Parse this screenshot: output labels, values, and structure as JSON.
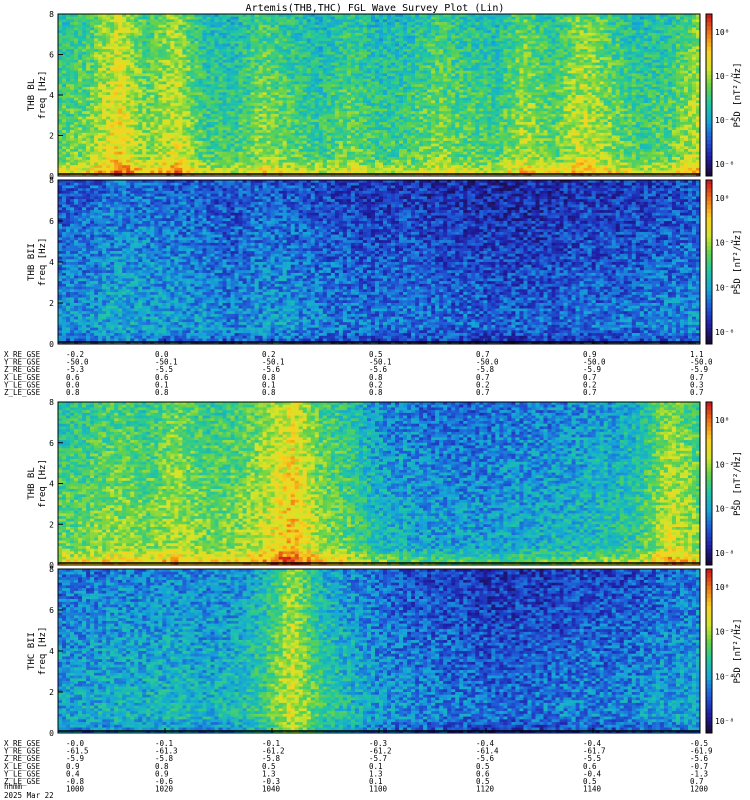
{
  "title": "Artemis(THB,THC) FGL Wave Survey Plot (Lin)",
  "date_label": "2025 Mar 22",
  "time_axis_label": "hhmm",
  "colorbar_label": "PSD [nT²/Hz]",
  "colors": {
    "colormap": [
      "#1b0a3b",
      "#1f1fa8",
      "#1f5ad8",
      "#15a6d8",
      "#20c6a2",
      "#63d24a",
      "#d4e427",
      "#fbd01f",
      "#f07a14",
      "#d01b1b"
    ]
  },
  "chart_data": [
    {
      "type": "heatmap",
      "panel": "THB BL",
      "ylabel_top": "THB BL",
      "ylabel_bottom": "freq [Hz]",
      "ylim": [
        0,
        8
      ],
      "y_ticks": [
        "0",
        "2",
        "4",
        "6",
        "8"
      ],
      "colorbar_ticks": [
        "10⁻⁶",
        "10⁻⁴",
        "10⁻²",
        "10⁰"
      ],
      "level_profile": [
        0.55,
        0.6,
        0.78,
        0.6,
        0.72,
        0.52,
        0.5,
        0.62,
        0.55,
        0.5,
        0.58,
        0.5,
        0.52,
        0.6,
        0.55,
        0.52,
        0.65,
        0.55,
        0.7,
        0.6,
        0.52,
        0.55,
        0.68
      ]
    },
    {
      "type": "heatmap",
      "panel": "THB BII",
      "ylabel_top": "THB BII",
      "ylabel_bottom": "freq [Hz]",
      "ylim": [
        0,
        8
      ],
      "y_ticks": [
        "0",
        "2",
        "4",
        "6",
        "8"
      ],
      "colorbar_ticks": [
        "10⁻⁶",
        "10⁻⁴",
        "10⁻²",
        "10⁰"
      ],
      "level_profile": [
        0.32,
        0.34,
        0.38,
        0.36,
        0.35,
        0.33,
        0.3,
        0.34,
        0.33,
        0.3,
        0.28,
        0.27,
        0.28,
        0.26,
        0.25,
        0.24,
        0.24,
        0.25,
        0.27,
        0.26,
        0.28,
        0.3,
        0.32
      ]
    },
    {
      "type": "heatmap",
      "panel": "THB BL (THC)",
      "ylabel_top": "THB BL",
      "ylabel_bottom": "freq [Hz]",
      "ylim": [
        0,
        8
      ],
      "y_ticks": [
        "0",
        "2",
        "4",
        "6",
        "8"
      ],
      "colorbar_ticks": [
        "10⁻⁸",
        "10⁻⁴",
        "10⁻²",
        "10⁰"
      ],
      "level_profile": [
        0.55,
        0.58,
        0.62,
        0.58,
        0.66,
        0.58,
        0.6,
        0.68,
        0.82,
        0.62,
        0.55,
        0.42,
        0.38,
        0.36,
        0.35,
        0.36,
        0.38,
        0.4,
        0.42,
        0.45,
        0.5,
        0.7,
        0.6
      ]
    },
    {
      "type": "heatmap",
      "panel": "THC BII",
      "ylabel_top": "THC BII",
      "ylabel_bottom": "freq [Hz]",
      "ylim": [
        0,
        8
      ],
      "y_ticks": [
        "0",
        "2",
        "4",
        "6",
        "8"
      ],
      "colorbar_ticks": [
        "10⁻⁸",
        "10⁻⁴",
        "10⁻²",
        "10⁰"
      ],
      "level_profile": [
        0.36,
        0.38,
        0.4,
        0.4,
        0.42,
        0.4,
        0.42,
        0.5,
        0.72,
        0.5,
        0.42,
        0.35,
        0.32,
        0.3,
        0.28,
        0.26,
        0.27,
        0.28,
        0.3,
        0.3,
        0.32,
        0.36,
        0.38
      ]
    }
  ],
  "ephemeris_top": {
    "labels": [
      "X_RE_GSE",
      "Y_RE_GSE",
      "Z_RE_GSE",
      "X_LE_GSE",
      "Y_LE_GSE",
      "Z_LE_GSE"
    ],
    "columns": [
      [
        "-0.2",
        "-50.0",
        "-5.3",
        "0.6",
        "0.0",
        "0.8"
      ],
      [
        "0.0",
        "-50.1",
        "-5.5",
        "0.6",
        "0.1",
        "0.8"
      ],
      [
        "0.2",
        "-50.1",
        "-5.6",
        "0.8",
        "0.1",
        "0.8"
      ],
      [
        "0.5",
        "-50.1",
        "-5.6",
        "0.8",
        "0.2",
        "0.8"
      ],
      [
        "0.7",
        "-50.0",
        "-5.8",
        "0.7",
        "0.2",
        "0.7"
      ],
      [
        "0.9",
        "-50.0",
        "-5.9",
        "0.7",
        "0.2",
        "0.7"
      ],
      [
        "1.1",
        "-50.0",
        "-5.9",
        "0.7",
        "0.3",
        "0.7"
      ]
    ]
  },
  "ephemeris_bottom": {
    "labels": [
      "X_RE_GSE",
      "Y_RE_GSE",
      "Z_RE_GSE",
      "X_LE_GSE",
      "Y_LE_GSE",
      "Z_LE_GSE"
    ],
    "columns": [
      [
        "-0.0",
        "-61.5",
        "-5.9",
        "0.9",
        "0.4",
        "-0.8",
        "1000"
      ],
      [
        "-0.1",
        "-61.3",
        "-5.8",
        "0.8",
        "0.9",
        "-0.6",
        "1020"
      ],
      [
        "-0.1",
        "-61.2",
        "-5.8",
        "0.5",
        "1.3",
        "-0.3",
        "1040"
      ],
      [
        "-0.3",
        "-61.2",
        "-5.7",
        "0.1",
        "1.3",
        "0.1",
        "1100"
      ],
      [
        "-0.4",
        "-61.4",
        "-5.6",
        "0.5",
        "0.6",
        "0.5",
        "1120"
      ],
      [
        "-0.4",
        "-61.7",
        "-5.5",
        "0.6",
        "-0.4",
        "0.5",
        "1140"
      ],
      [
        "-0.5",
        "-61.9",
        "-5.6",
        "-0.7",
        "-1.3",
        "0.7",
        "1200"
      ]
    ]
  }
}
